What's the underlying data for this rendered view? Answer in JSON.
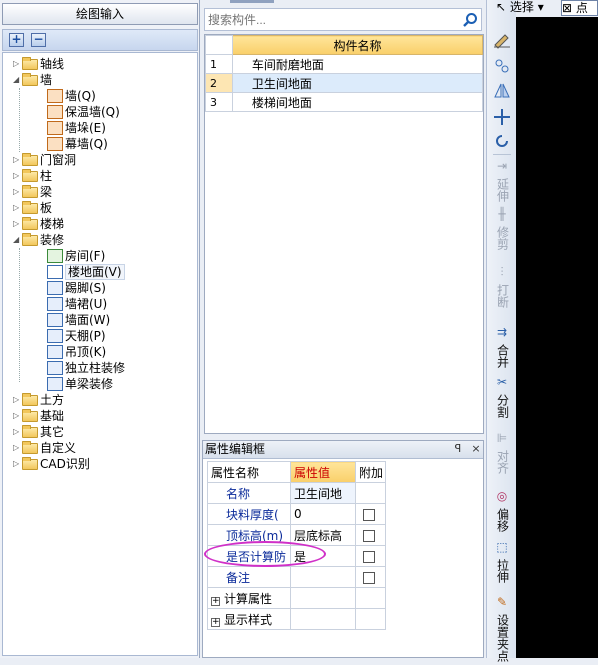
{
  "left_panel": {
    "title": "绘图输入",
    "toolbar": {
      "add": "+",
      "remove": "−"
    },
    "tree": {
      "axis": "轴线",
      "wall": "墙",
      "wall_children": [
        "墙(Q)",
        "保温墙(Q)",
        "墙垛(E)",
        "幕墙(Q)"
      ],
      "door_window": "门窗洞",
      "column": "柱",
      "beam": "梁",
      "slab": "板",
      "stair": "楼梯",
      "decoration": "装修",
      "decoration_children": [
        "房间(F)",
        "楼地面(V)",
        "踢脚(S)",
        "墙裙(U)",
        "墙面(W)",
        "天棚(P)",
        "吊顶(K)",
        "独立柱装修",
        "单梁装修"
      ],
      "earthwork": "土方",
      "foundation": "基础",
      "other": "其它",
      "custom": "自定义",
      "cad": "CAD识别"
    }
  },
  "search": {
    "placeholder": "搜索构件..."
  },
  "component_table": {
    "header": "构件名称",
    "rows": [
      {
        "num": "1",
        "name": "车间耐磨地面"
      },
      {
        "num": "2",
        "name": "卫生间地面"
      },
      {
        "num": "3",
        "name": "楼梯间地面"
      }
    ]
  },
  "property_editor": {
    "title": "属性编辑框",
    "pin": "ꟼ",
    "close": "×",
    "columns": [
      "属性名称",
      "属性值",
      "附加"
    ],
    "rows": [
      {
        "name": "名称",
        "value": "卫生间地",
        "checkbox": false
      },
      {
        "name": "块料厚度(",
        "value": "0",
        "checkbox": true
      },
      {
        "name": "顶标高(m)",
        "value": "层底标高",
        "checkbox": true
      },
      {
        "name": "是否计算防",
        "value": "是",
        "checkbox": true
      },
      {
        "name": "备注",
        "value": "",
        "checkbox": true
      }
    ],
    "groups": [
      "计算属性",
      "显示样式"
    ]
  },
  "right_toolbar": {
    "select": "选择",
    "point": "点",
    "items": [
      "延伸",
      "修剪",
      "打断",
      "合并",
      "分割",
      "对齐",
      "偏移",
      "拉伸",
      "设置夹点"
    ]
  },
  "colors": {
    "header_gold": "#f9cf6a",
    "selected_row": "#dcebfb",
    "highlight_oval": "#d030c8",
    "canvas": "#000000"
  }
}
